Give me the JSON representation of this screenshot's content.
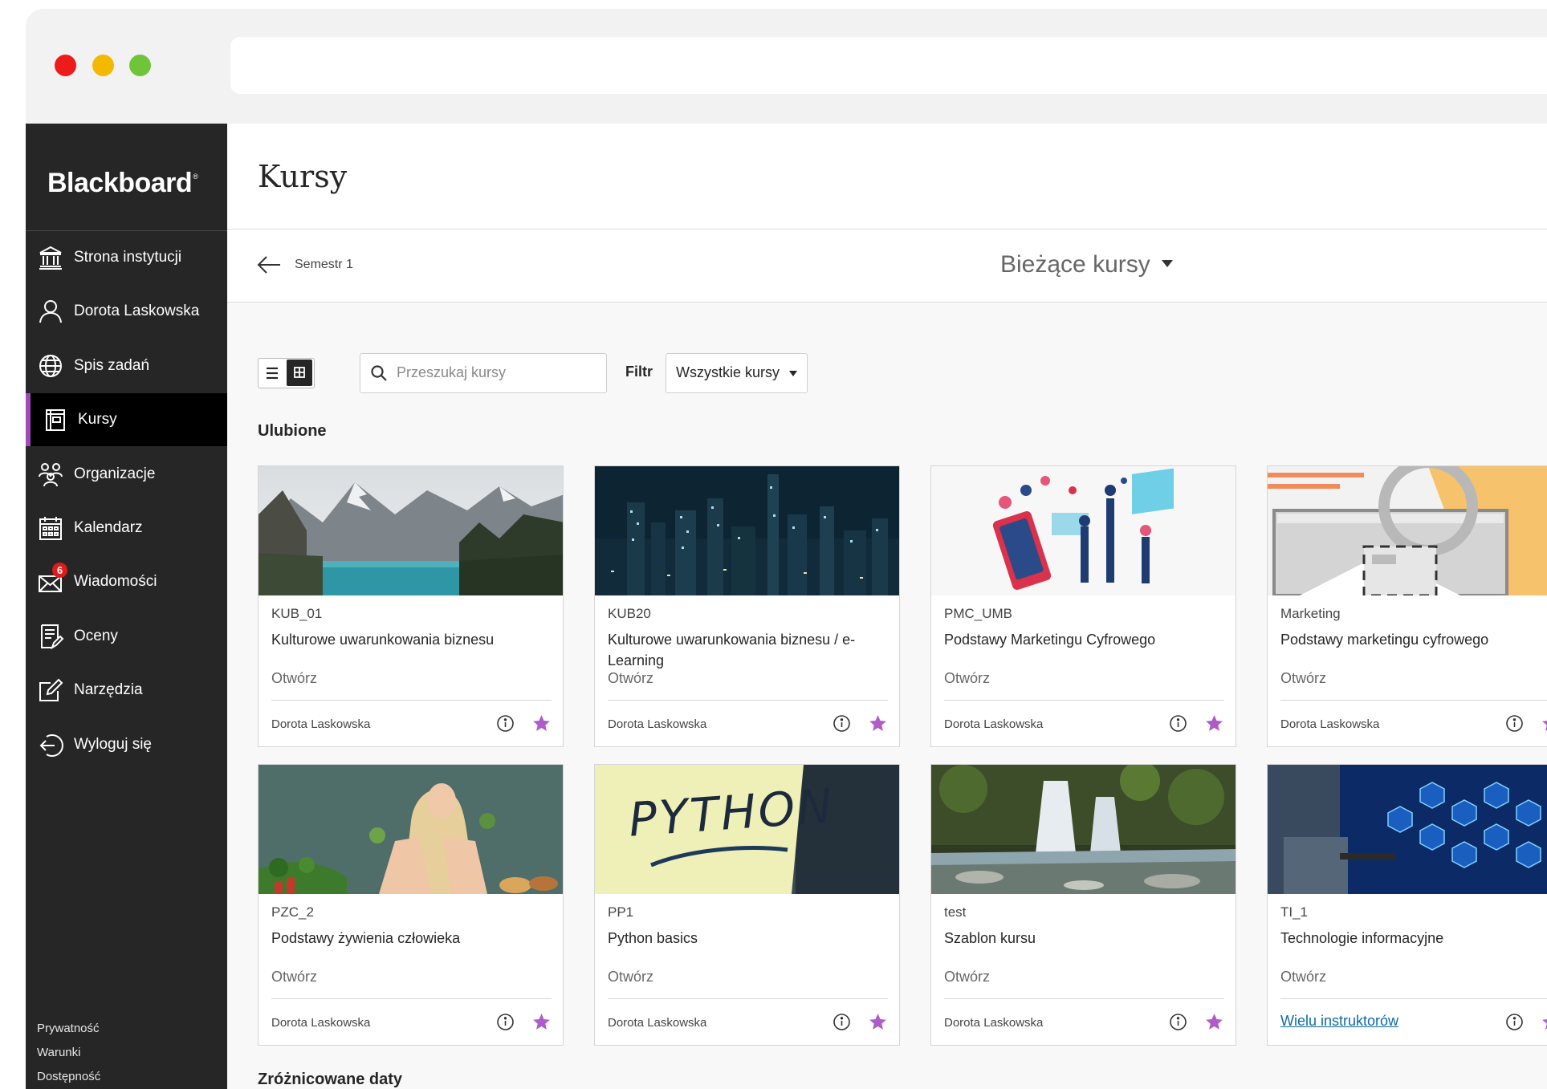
{
  "window": {
    "dot_colors": [
      "#ee1b1b",
      "#f5b800",
      "#6fc43a"
    ]
  },
  "sidebar": {
    "logo": "Blackboard",
    "logo_mark": "®",
    "items": [
      {
        "label": "Strona instytucji",
        "icon": "institution-icon"
      },
      {
        "label": "Dorota Laskowska",
        "icon": "user-icon"
      },
      {
        "label": "Spis zadań",
        "icon": "globe-icon"
      },
      {
        "label": "Kursy",
        "icon": "courses-icon",
        "active": true
      },
      {
        "label": "Organizacje",
        "icon": "organizations-icon"
      },
      {
        "label": "Kalendarz",
        "icon": "calendar-icon"
      },
      {
        "label": "Wiadomości",
        "icon": "messages-icon",
        "badge": "6"
      },
      {
        "label": "Oceny",
        "icon": "grades-icon"
      },
      {
        "label": "Narzędzia",
        "icon": "tools-icon"
      },
      {
        "label": "Wyloguj się",
        "icon": "logout-icon"
      }
    ],
    "footer": [
      "Prywatność",
      "Warunki",
      "Dostępność"
    ]
  },
  "header": {
    "title": "Kursy"
  },
  "subheader": {
    "term": "Semestr 1",
    "current": "Bieżące kursy"
  },
  "toolbar": {
    "search_placeholder": "Przeszukaj kursy",
    "filter_label": "Filtr",
    "filter_value": "Wszystkie kursy"
  },
  "sections": {
    "favorites": "Ulubione",
    "different_dates": "Zróżnicowane daty"
  },
  "courses": [
    {
      "code": "KUB_01",
      "name": "Kulturowe uwarunkowania biznesu",
      "action": "Otwórz",
      "instructor": "Dorota Laskowska",
      "favorite": true
    },
    {
      "code": "KUB20",
      "name": "Kulturowe uwarunkowania biznesu / e-Learning",
      "action": "Otwórz",
      "instructor": "Dorota Laskowska",
      "favorite": true
    },
    {
      "code": "PMC_UMB",
      "name": "Podstawy Marketingu Cyfrowego",
      "action": "Otwórz",
      "instructor": "Dorota Laskowska",
      "favorite": true
    },
    {
      "code": "Marketing",
      "name": "Podstawy marketingu cyfrowego",
      "action": "Otwórz",
      "instructor": "Dorota Laskowska",
      "favorite": true
    },
    {
      "code": "PZC_2",
      "name": "Podstawy żywienia człowieka",
      "action": "Otwórz",
      "instructor": "Dorota Laskowska",
      "favorite": true
    },
    {
      "code": "PP1",
      "name": "Python basics",
      "action": "Otwórz",
      "instructor": "Dorota Laskowska",
      "favorite": true
    },
    {
      "code": "test",
      "name": "Szablon kursu",
      "action": "Otwórz",
      "instructor": "Dorota Laskowska",
      "favorite": true
    },
    {
      "code": "TI_1",
      "name": "Technologie informacyjne",
      "action": "Otwórz",
      "instructor": "Wielu instruktorów",
      "instructor_is_link": true,
      "favorite": true
    }
  ],
  "course_images": {
    "python_text": "PYTHON"
  },
  "colors": {
    "accent": "#9e4bb8",
    "star": "#b05cc8",
    "link": "#0f6aa6",
    "sidebar_bg": "#262626"
  }
}
